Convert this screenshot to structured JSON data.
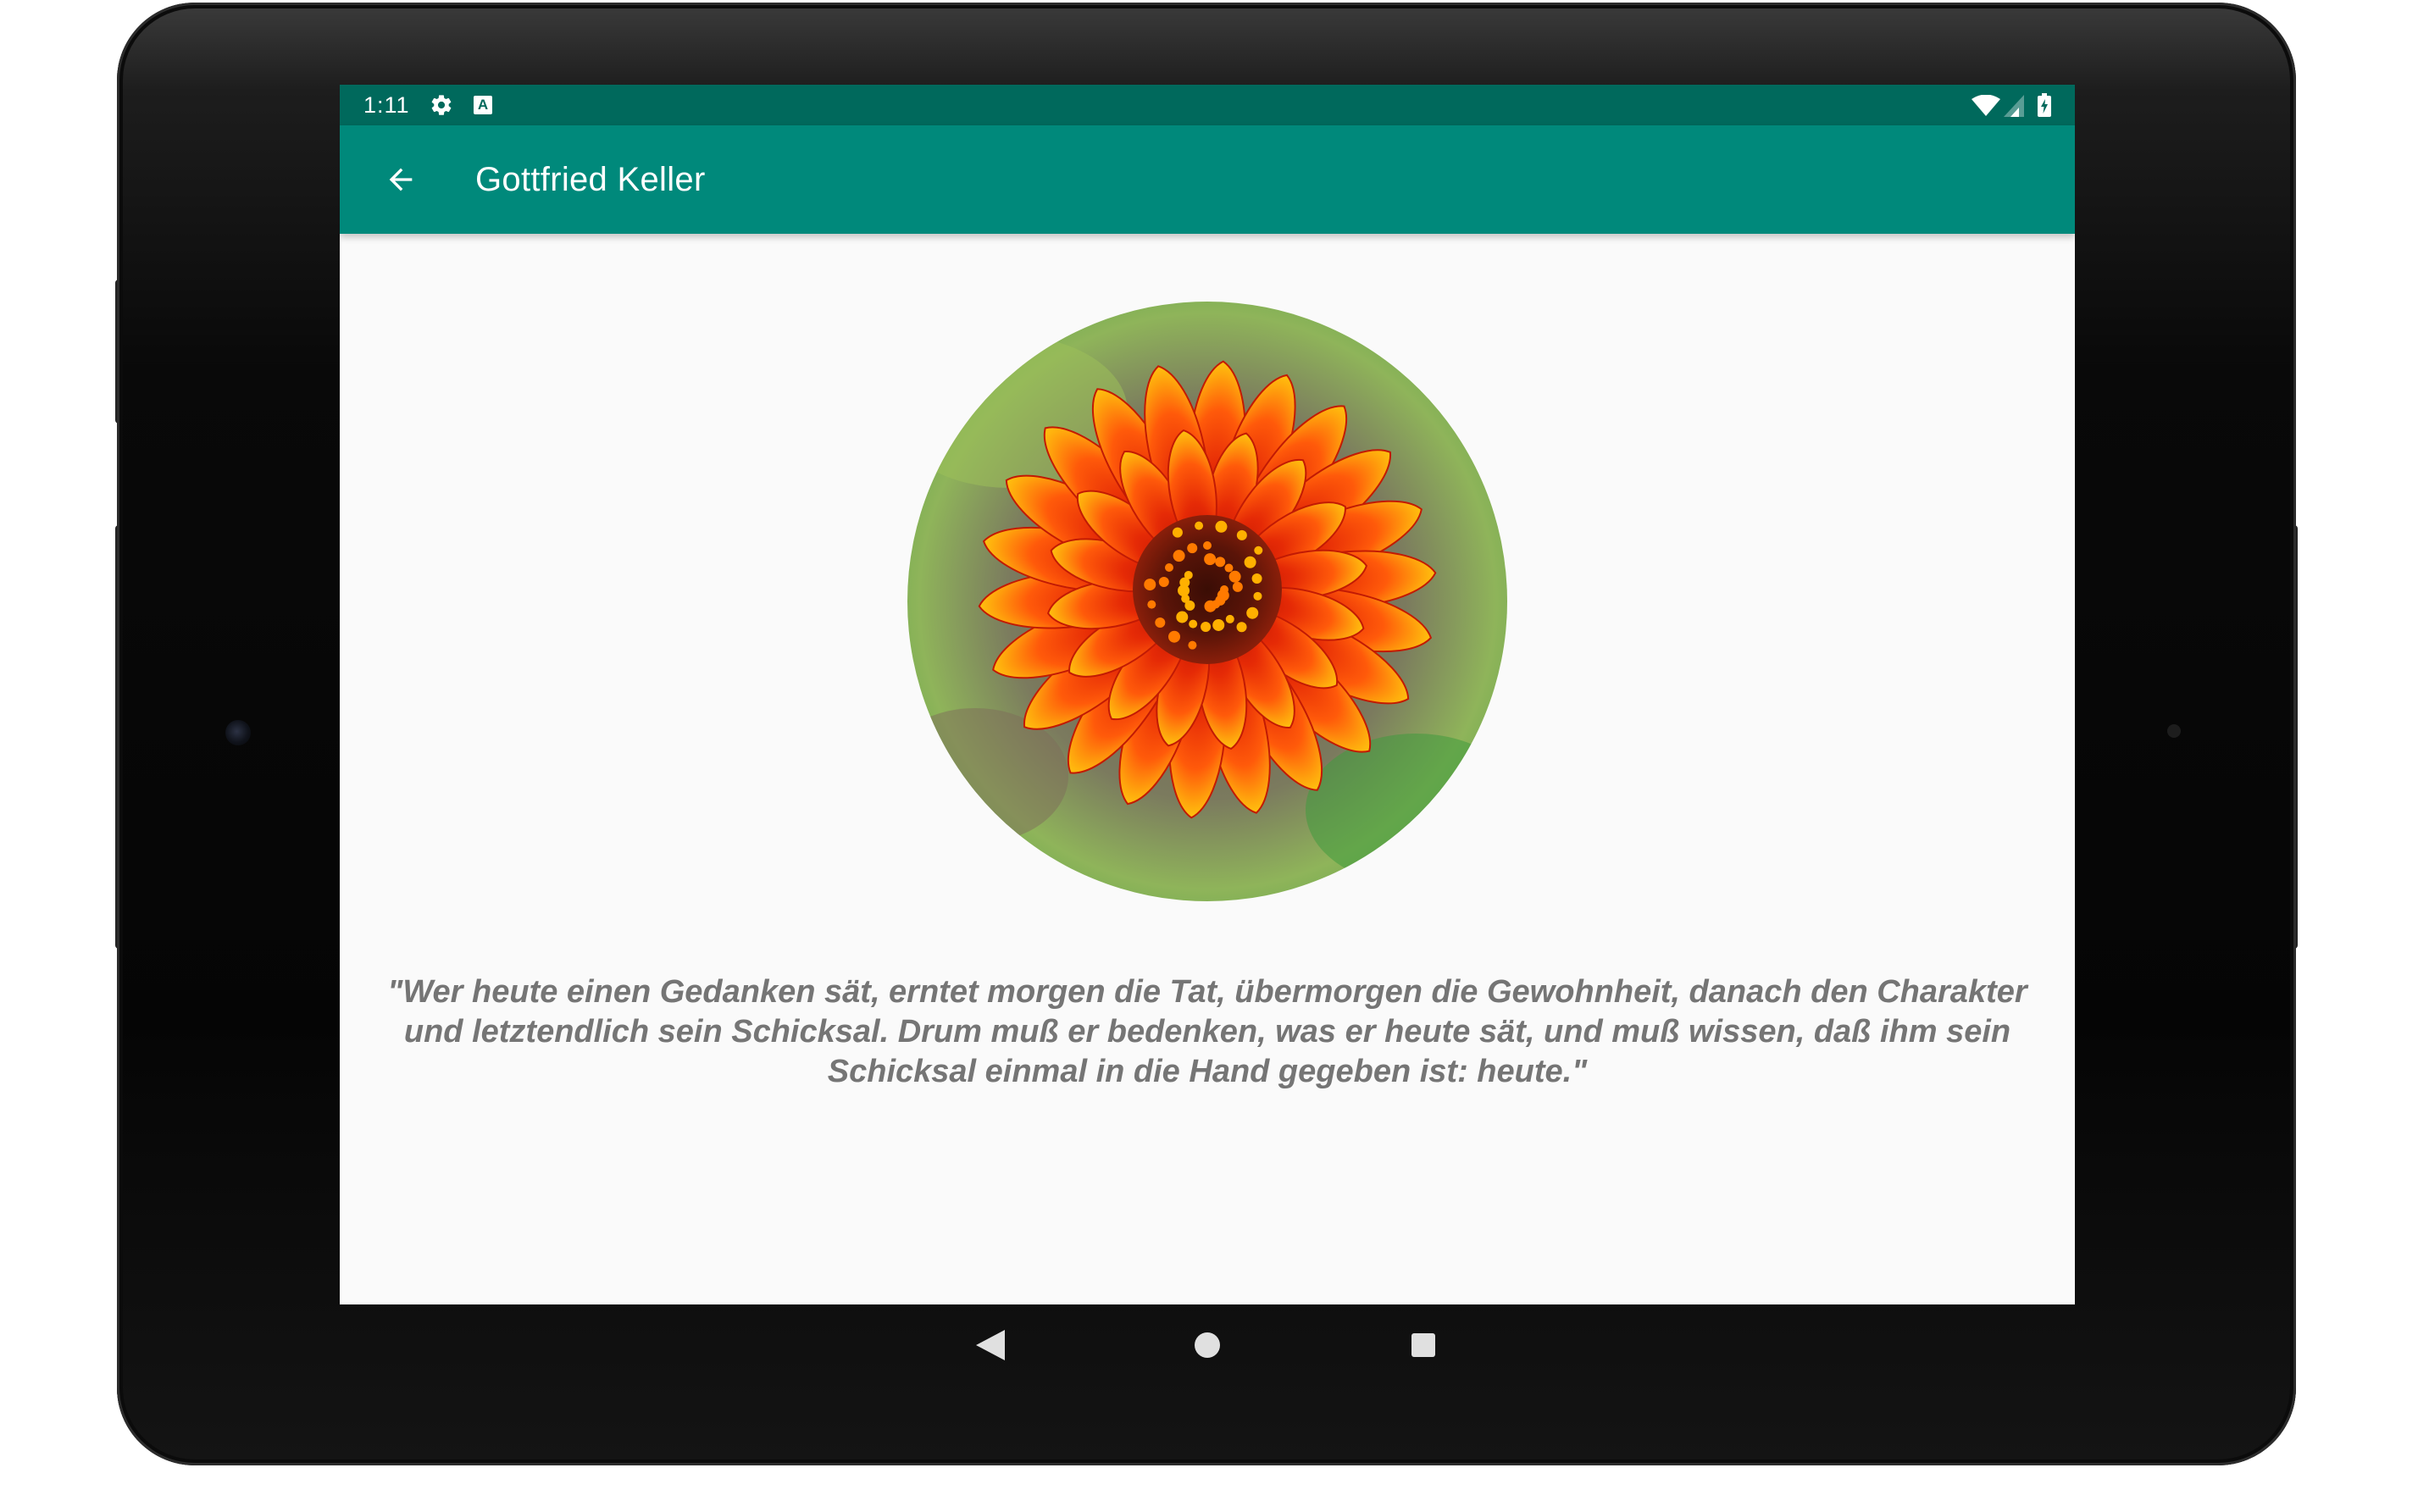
{
  "status_bar": {
    "time": "1:11",
    "notification_icons": [
      "gear-icon",
      "a-badge-icon"
    ],
    "notification_badge_letter": "A",
    "system_icons": [
      "wifi-icon",
      "cell-signal-icon",
      "battery-charging-icon"
    ],
    "color": "#00695c"
  },
  "app_bar": {
    "title": "Gottfried Keller",
    "nav_icon": "arrow-back-icon",
    "color": "#00897b"
  },
  "content": {
    "image": "red-yellow-flower-circle",
    "quote": "\"Wer heute einen Gedanken sät, erntet morgen die Tat, übermorgen die Gewohnheit, danach den Charakter und letztendlich sein Schicksal. Drum muß er bedenken, was er heute sät, und muß wissen, daß ihm sein Schicksal einmal in die Hand gegeben ist: heute.\"",
    "quote_color": "#757575",
    "background": "#fafafa"
  },
  "navigation_bar": {
    "buttons": [
      "nav-back-icon",
      "nav-home-icon",
      "nav-recents-icon"
    ]
  }
}
